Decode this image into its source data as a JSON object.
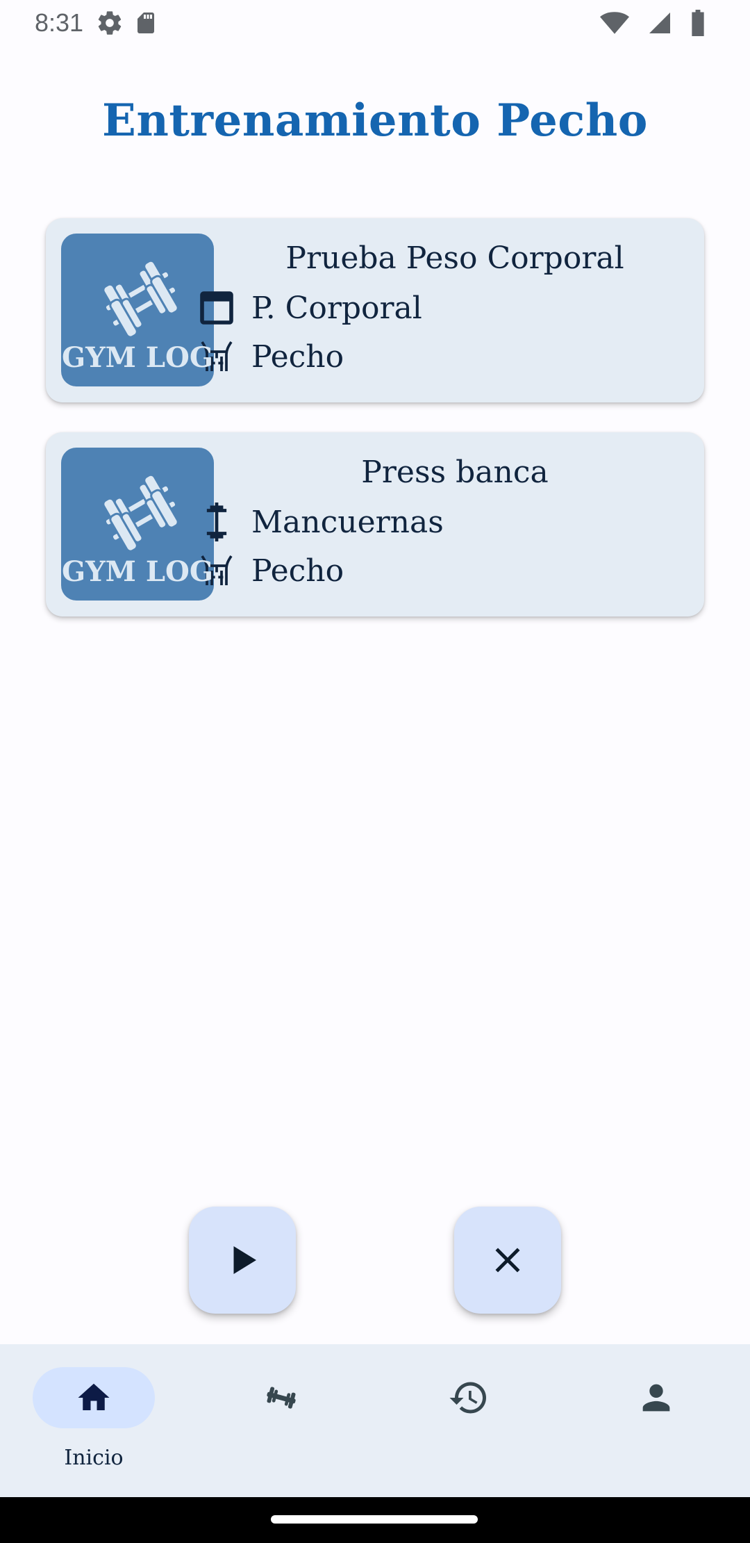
{
  "status_bar": {
    "time": "8:31",
    "icons_left": [
      "settings-icon",
      "sd-card-icon"
    ],
    "icons_right": [
      "wifi-icon",
      "signal-icon",
      "battery-icon"
    ]
  },
  "page": {
    "title": "Entrenamiento Pecho",
    "title_color": "#1565b0"
  },
  "exercises": [
    {
      "name": "Prueba Peso Corporal",
      "thumb_text": "GYM LOG",
      "equipment": "P. Corporal",
      "equipment_icon": "scale-icon",
      "muscle": "Pecho",
      "muscle_icon": "chest-icon"
    },
    {
      "name": "Press banca",
      "thumb_text": "GYM LOG",
      "equipment": "Mancuernas",
      "equipment_icon": "dumbbell-icon",
      "muscle": "Pecho",
      "muscle_icon": "chest-icon"
    }
  ],
  "actions": {
    "start_icon": "play-icon",
    "cancel_icon": "close-icon",
    "button_bg": "#d7e3fb"
  },
  "bottom_nav": {
    "items": [
      {
        "label": "Inicio",
        "icon": "home-icon",
        "active": true
      },
      {
        "label": "",
        "icon": "dumbbell-icon",
        "active": false
      },
      {
        "label": "",
        "icon": "history-icon",
        "active": false
      },
      {
        "label": "",
        "icon": "person-icon",
        "active": false
      }
    ]
  }
}
